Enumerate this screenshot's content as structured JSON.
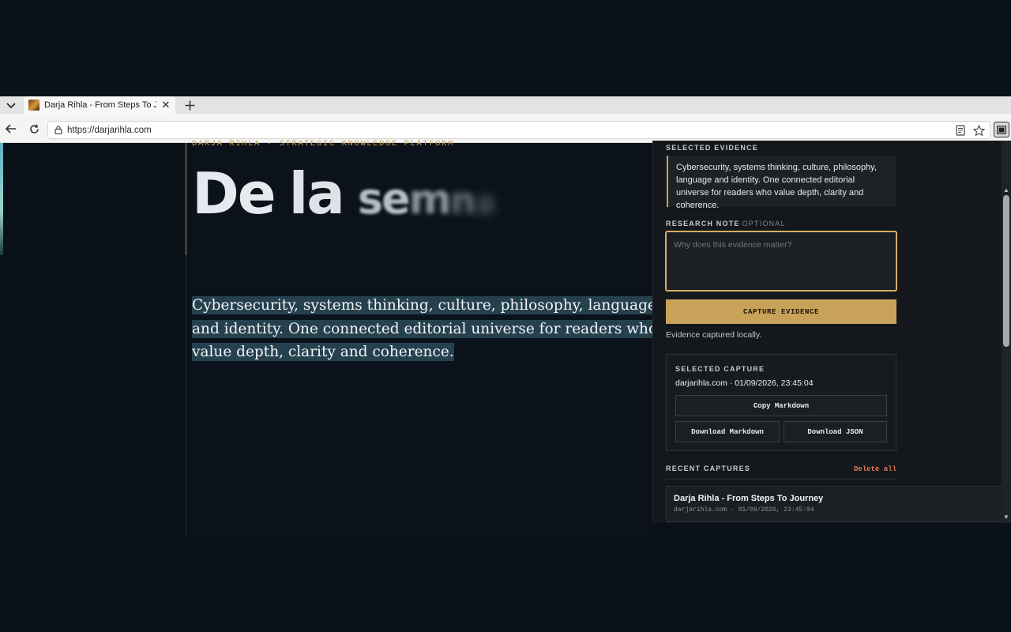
{
  "browser": {
    "tab_title": "Darja Rihla - From Steps To Journey",
    "url": "https://darjarihla.com"
  },
  "page": {
    "eyebrow": "DARJA RIHLA · STRATEGIC KNOWLEDGE PLATFORM",
    "hero_words": [
      "De",
      "la",
      "se",
      "m",
      "n",
      "a"
    ],
    "lede": "Cybersecurity, systems thinking, culture, philosophy, language and identity. One connected editorial universe for readers who value depth, clarity and coherence."
  },
  "panel": {
    "selected_evidence_label": "SELECTED EVIDENCE",
    "selected_evidence_text": "Cybersecurity, systems thinking, culture, philosophy, language and identity. One connected editorial universe for readers who value depth, clarity and coherence.",
    "research_note_label": "RESEARCH NOTE",
    "research_note_optional": "OPTIONAL",
    "research_note_placeholder": "Why does this evidence matter?",
    "capture_button": "CAPTURE EVIDENCE",
    "status": "Evidence captured locally.",
    "selected_capture_label": "SELECTED CAPTURE",
    "selected_capture_meta": "darjarihla.com · 01/09/2026, 23:45:04",
    "copy_markdown": "Copy Markdown",
    "download_markdown": "Download Markdown",
    "download_json": "Download JSON",
    "recent_label": "RECENT CAPTURES",
    "delete_all": "Delete all",
    "recent": [
      {
        "title": "Darja Rihla - From Steps To Journey",
        "meta": "darjarihla.com · 01/09/2026, 23:45:04"
      }
    ]
  },
  "colors": {
    "accent_gold": "#c9a25a",
    "danger": "#e07a56",
    "selection": "#26414e"
  }
}
